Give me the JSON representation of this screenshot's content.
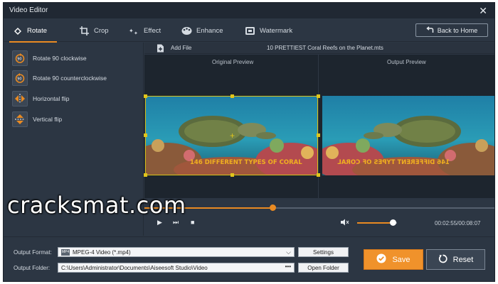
{
  "window": {
    "title": "Video Editor"
  },
  "tabs": [
    {
      "label": "Rotate",
      "icon": "rotate-icon",
      "active": true
    },
    {
      "label": "Crop",
      "icon": "crop-icon"
    },
    {
      "label": "Effect",
      "icon": "effect-icon"
    },
    {
      "label": "Enhance",
      "icon": "enhance-icon"
    },
    {
      "label": "Watermark",
      "icon": "watermark-icon"
    }
  ],
  "back_button": "Back to Home",
  "rotate_options": [
    {
      "label": "Rotate 90 clockwise",
      "icon": "rotate-cw-icon"
    },
    {
      "label": "Rotate 90 counterclockwise",
      "icon": "rotate-ccw-icon"
    },
    {
      "label": "Horizontal flip",
      "icon": "flip-horizontal-icon"
    },
    {
      "label": "Vertical flip",
      "icon": "flip-vertical-icon"
    }
  ],
  "file": {
    "add_label": "Add File",
    "name": "10 PRETTIEST Coral Reefs on the Planet.mts"
  },
  "preview": {
    "original_label": "Original Preview",
    "output_label": "Output Preview",
    "caption": "146 DIFFERENT TYPES OF CORAL"
  },
  "playback": {
    "progress": 0.365,
    "volume": 0.9,
    "time": "00:02:55/00:08:07"
  },
  "watermark_text": "cracksmat.com",
  "output": {
    "format_label": "Output Format:",
    "format_value": "MPEG-4 Video (*.mp4)",
    "settings_label": "Settings",
    "folder_label": "Output Folder:",
    "folder_value": "C:\\Users\\Administrator\\Documents\\Aiseesoft Studio\\Video",
    "folder_dots": "•••",
    "open_folder_label": "Open Folder"
  },
  "save_label": "Save",
  "reset_label": "Reset",
  "colors": {
    "accent": "#e98a22",
    "background": "#2c3643",
    "selection": "#d8c21a"
  }
}
